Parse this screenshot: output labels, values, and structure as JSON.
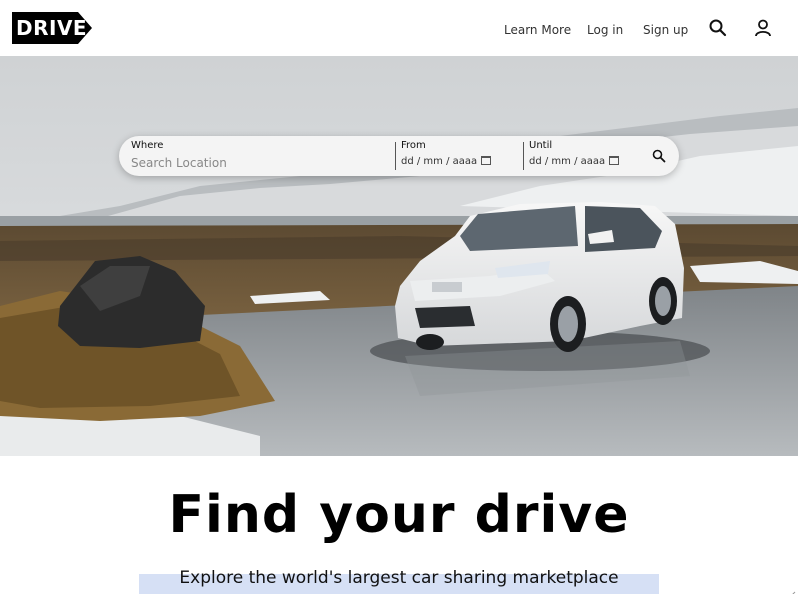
{
  "header": {
    "logo_text": "DRIVE",
    "nav": {
      "learn_more": "Learn More",
      "log_in": "Log in",
      "sign_up": "Sign up"
    },
    "icons": [
      "search-icon",
      "user-icon"
    ]
  },
  "search": {
    "where_label": "Where",
    "where_placeholder": "Search Location",
    "from_label": "From",
    "from_value": "dd / mm / aaaa",
    "until_label": "Until",
    "until_value": "dd / mm / aaaa",
    "submit_icon": "search-icon"
  },
  "hero": {
    "headline": "Find your drive",
    "subheadline": "Explore the world's largest car sharing marketplace"
  },
  "colors": {
    "logo_bg": "#000000",
    "page_bg": "#ffffff",
    "selection": "#d6e0f5"
  }
}
